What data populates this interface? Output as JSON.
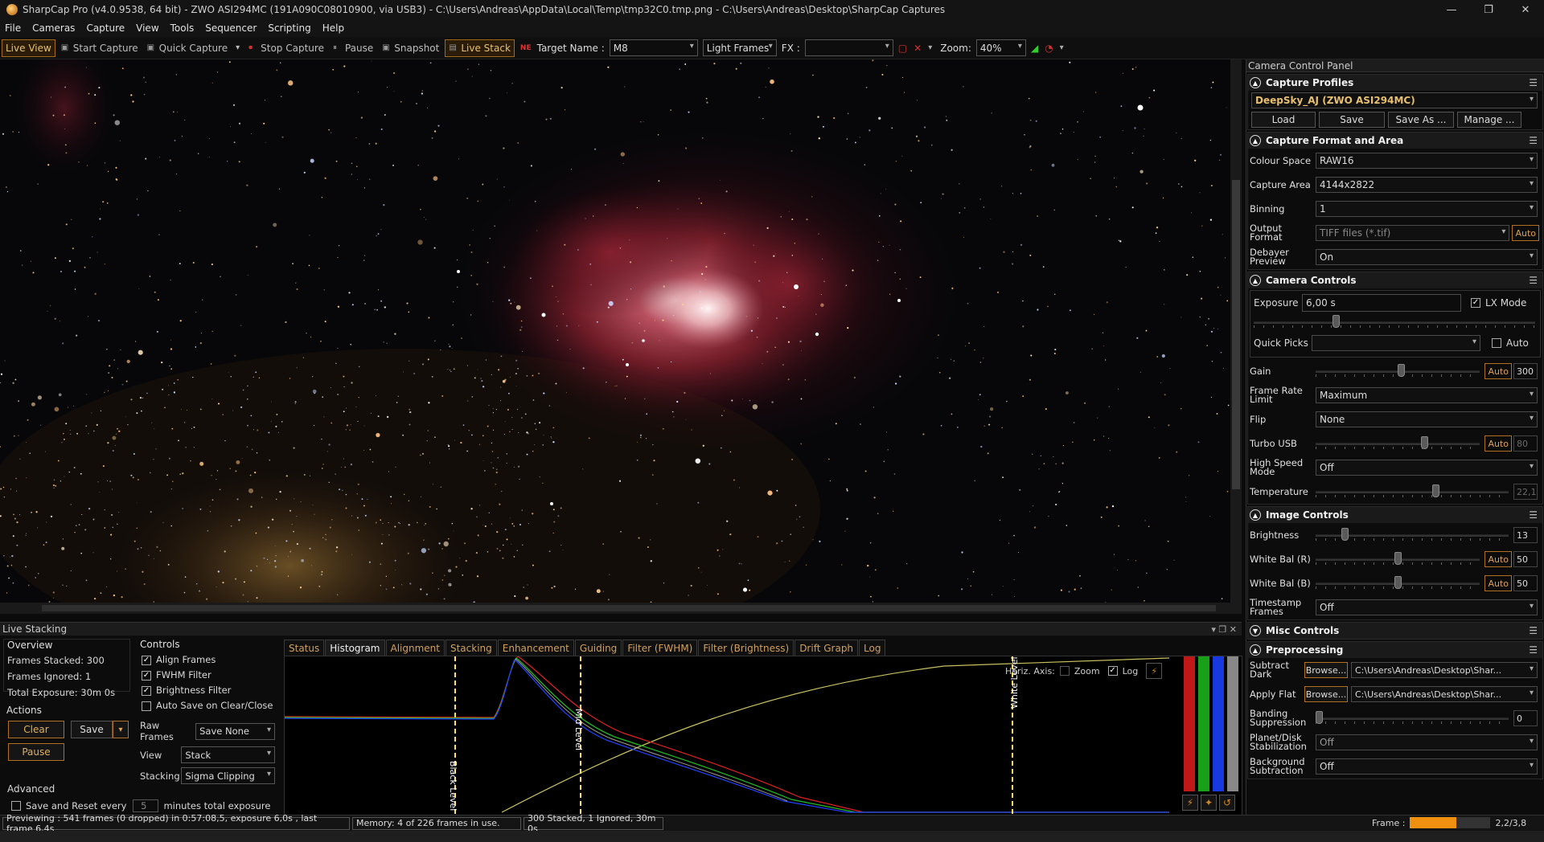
{
  "window": {
    "title": "SharpCap Pro (v4.0.9538, 64 bit) - ZWO ASI294MC (191A090C08010900, via USB3) - C:\\Users\\Andreas\\AppData\\Local\\Temp\\tmp32C0.tmp.png - C:\\Users\\Andreas\\Desktop\\SharpCap Captures",
    "minimize": "—",
    "maximize": "❐",
    "close": "✕"
  },
  "menu": [
    "File",
    "Cameras",
    "Capture",
    "View",
    "Tools",
    "Sequencer",
    "Scripting",
    "Help"
  ],
  "toolbar": {
    "live_view": "Live View",
    "start_capture": "Start Capture",
    "quick_capture": "Quick Capture",
    "stop_capture": "Stop Capture",
    "pause": "Pause",
    "snapshot": "Snapshot",
    "live_stack": "Live Stack",
    "target_label": "Target Name :",
    "target_value": "M8",
    "frame_type": "Light Frames",
    "fx_label": "FX :",
    "fx_value": "",
    "zoom_label": "Zoom:",
    "zoom_value": "40%"
  },
  "ccp": {
    "title": "Camera Control Panel",
    "capture_profiles": {
      "title": "Capture Profiles",
      "profile": "DeepSky_AJ (ZWO ASI294MC)",
      "load": "Load",
      "save": "Save",
      "save_as": "Save As ...",
      "manage": "Manage ..."
    },
    "capture_format": {
      "title": "Capture Format and Area",
      "colour_space_label": "Colour Space",
      "colour_space": "RAW16",
      "capture_area_label": "Capture Area",
      "capture_area": "4144x2822",
      "binning_label": "Binning",
      "binning": "1",
      "output_format_label": "Output Format",
      "output_format": "TIFF files (*.tif)",
      "auto": "Auto",
      "debayer_label": "Debayer Preview",
      "debayer": "On"
    },
    "camera_controls": {
      "title": "Camera Controls",
      "exposure_label": "Exposure",
      "exposure": "6,00 s",
      "lx_mode": "LX Mode",
      "quick_picks_label": "Quick Picks",
      "quick_picks": "",
      "auto": "Auto",
      "gain_label": "Gain",
      "gain": "300",
      "gain_level": 0.52,
      "frame_rate_label": "Frame Rate Limit",
      "frame_rate": "Maximum",
      "flip_label": "Flip",
      "flip": "None",
      "turbo_label": "Turbo USB",
      "turbo": "80",
      "turbo_level": 0.66,
      "highspeed_label": "High Speed Mode",
      "highspeed": "Off",
      "temp_label": "Temperature",
      "temp": "22,1",
      "temp_level": 0.62
    },
    "image_controls": {
      "title": "Image Controls",
      "brightness_label": "Brightness",
      "brightness": "13",
      "brightness_level": 0.15,
      "wbr_label": "White Bal (R)",
      "wbr": "50",
      "wbr_level": 0.5,
      "wbb_label": "White Bal (B)",
      "wbb": "50",
      "wbb_level": 0.5,
      "timestamp_label": "Timestamp Frames",
      "timestamp": "Off"
    },
    "misc_controls": {
      "title": "Misc Controls"
    },
    "preprocessing": {
      "title": "Preprocessing",
      "dark_label": "Subtract Dark",
      "browse": "Browse...",
      "dark_path": "C:\\Users\\Andreas\\Desktop\\Shar...",
      "flat_label": "Apply Flat",
      "flat_path": "C:\\Users\\Andreas\\Desktop\\Shar...",
      "banding_label": "Banding Suppression",
      "banding": "0",
      "planet_label": "Planet/Disk Stabilization",
      "planet": "Off",
      "background_label": "Background Subtraction",
      "background": "Off"
    }
  },
  "live_stacking": {
    "title": "Live Stacking",
    "overview": {
      "title": "Overview",
      "stacked": "Frames Stacked: 300",
      "ignored": "Frames Ignored: 1",
      "exposure": "Total Exposure:    30m 0s"
    },
    "actions": {
      "title": "Actions",
      "clear": "Clear",
      "save": "Save",
      "pause": "Pause"
    },
    "advanced": {
      "title": "Advanced",
      "save_reset": "Save and Reset every",
      "minutes": "5",
      "suffix": "minutes total exposure"
    },
    "controls": {
      "title": "Controls",
      "align": "Align Frames",
      "fwhm": "FWHM Filter",
      "brightness": "Brightness Filter",
      "autosave": "Auto Save on Clear/Close",
      "raw_label": "Raw Frames",
      "raw": "Save None",
      "view_label": "View",
      "view": "Stack",
      "stacking_label": "Stacking",
      "stacking": "Sigma Clipping"
    },
    "tabs": [
      "Status",
      "Histogram",
      "Alignment",
      "Stacking",
      "Enhancement",
      "Guiding",
      "Filter (FWHM)",
      "Filter (Brightness)",
      "Drift Graph",
      "Log"
    ],
    "histogram": {
      "horiz_axis": "Horiz. Axis:",
      "zoom": "Zoom",
      "log": "Log",
      "black_level": "Black Level",
      "mid_level": "Mid Level",
      "white_level": "White Level"
    }
  },
  "status": {
    "preview": "Previewing : 541 frames (0 dropped) in 0:57:08,5, exposure 6,0s , last frame 6,4s",
    "memory": "Memory: 4 of 226 frames in use.",
    "stack": "300 Stacked, 1 Ignored, 30m 0s",
    "frame_label": "Frame :",
    "frame_value": "2,2/3,8",
    "frame_progress": 0.58
  },
  "colors": {
    "accent": "#d08a20",
    "nebula": "#9a2a38",
    "red": "#e02020",
    "green": "#20c020",
    "blue": "#2040ff",
    "curve": "#c8c060"
  }
}
